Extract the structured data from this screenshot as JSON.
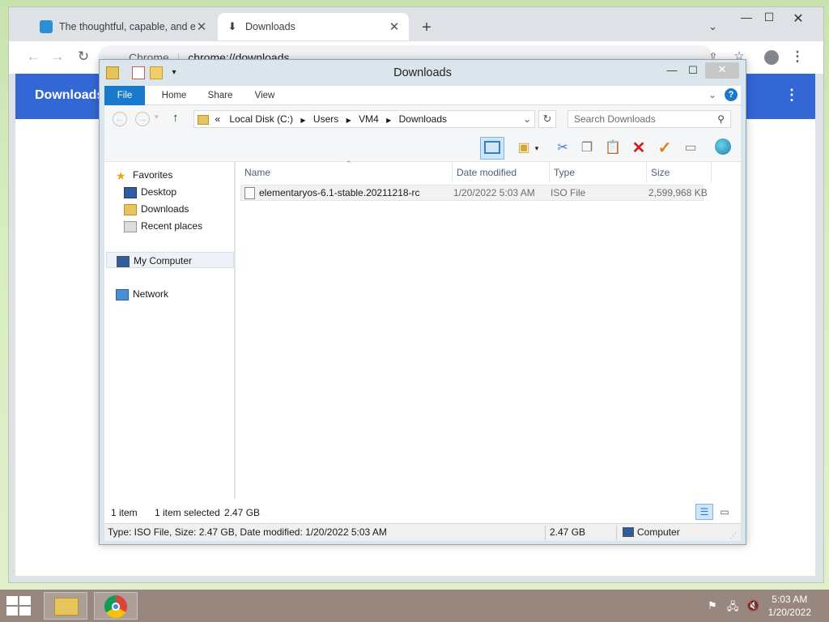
{
  "chrome": {
    "tabs": [
      {
        "label": "The thoughtful, capable, and eth"
      },
      {
        "label": "Downloads"
      }
    ],
    "omnibox_site": "Chrome",
    "omnibox_url": "chrome://downloads",
    "page_title": "Downloads",
    "accent": "#3367d6"
  },
  "explorer": {
    "title": "Downloads",
    "ribbon_tabs": [
      "File",
      "Home",
      "Share",
      "View"
    ],
    "address": {
      "prefix": "«",
      "crumbs": [
        "Local Disk (C:)",
        "Users",
        "VM4",
        "Downloads"
      ]
    },
    "search_placeholder": "Search Downloads",
    "nav": {
      "favorites": "Favorites",
      "favorites_items": [
        "Desktop",
        "Downloads",
        "Recent places"
      ],
      "computer": "My Computer",
      "network": "Network"
    },
    "columns": [
      "Name",
      "Date modified",
      "Type",
      "Size"
    ],
    "files": [
      {
        "name": "elementaryos-6.1-stable.20211218-rc",
        "date": "1/20/2022 5:03 AM",
        "type": "ISO File",
        "size": "2,599,968 KB"
      }
    ],
    "status": {
      "count": "1 item",
      "selected": "1 item selected",
      "selected_size": "2.47 GB"
    },
    "details_bar": {
      "info": "Type: ISO File, Size: 2.47 GB, Date modified: 1/20/2022 5:03 AM",
      "size": "2.47 GB",
      "location": "Computer"
    },
    "accent": "#1979ca"
  },
  "taskbar": {
    "time": "5:03 AM",
    "date": "1/20/2022"
  }
}
